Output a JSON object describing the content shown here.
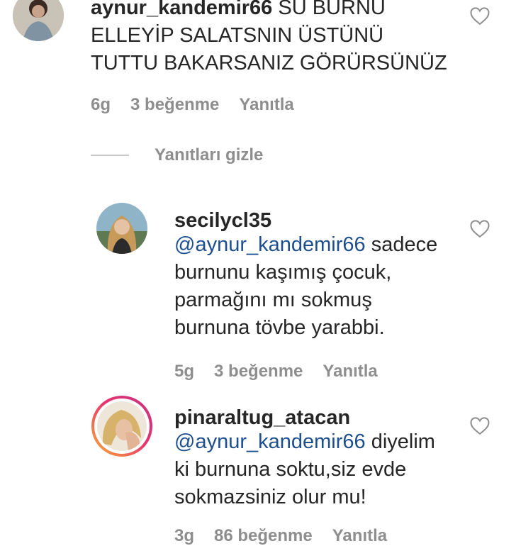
{
  "comment1": {
    "username": "aynur_kandemir66",
    "text": " SU BURNU\nELLEYİP SALATSNIN ÜSTÜNÜ\nTUTTU BAKARSANIZ GÖRÜRSÜNÜZ",
    "time": "6g",
    "likes": "3 beğenme",
    "reply": "Yanıtla"
  },
  "hide_replies": "Yanıtları gizle",
  "reply1": {
    "username": "secilycl35",
    "mention": "@aynur_kandemir66",
    "text": " sadece\nburnunu kaşımış çocuk,\nparmağını mı sokmuş\nburnuna tövbe yarabbi.",
    "time": "5g",
    "likes": "3 beğenme",
    "reply": "Yanıtla"
  },
  "reply2": {
    "username": "pinaraltug_atacan",
    "mention": "@aynur_kandemir66",
    "text": " diyelim\nki burnuna soktu,siz evde\nsokmazsiniz olur mu!",
    "time": "3g",
    "likes": "86 beğenme",
    "reply": "Yanıtla"
  },
  "icons": {
    "like": "heart-outline-icon"
  }
}
